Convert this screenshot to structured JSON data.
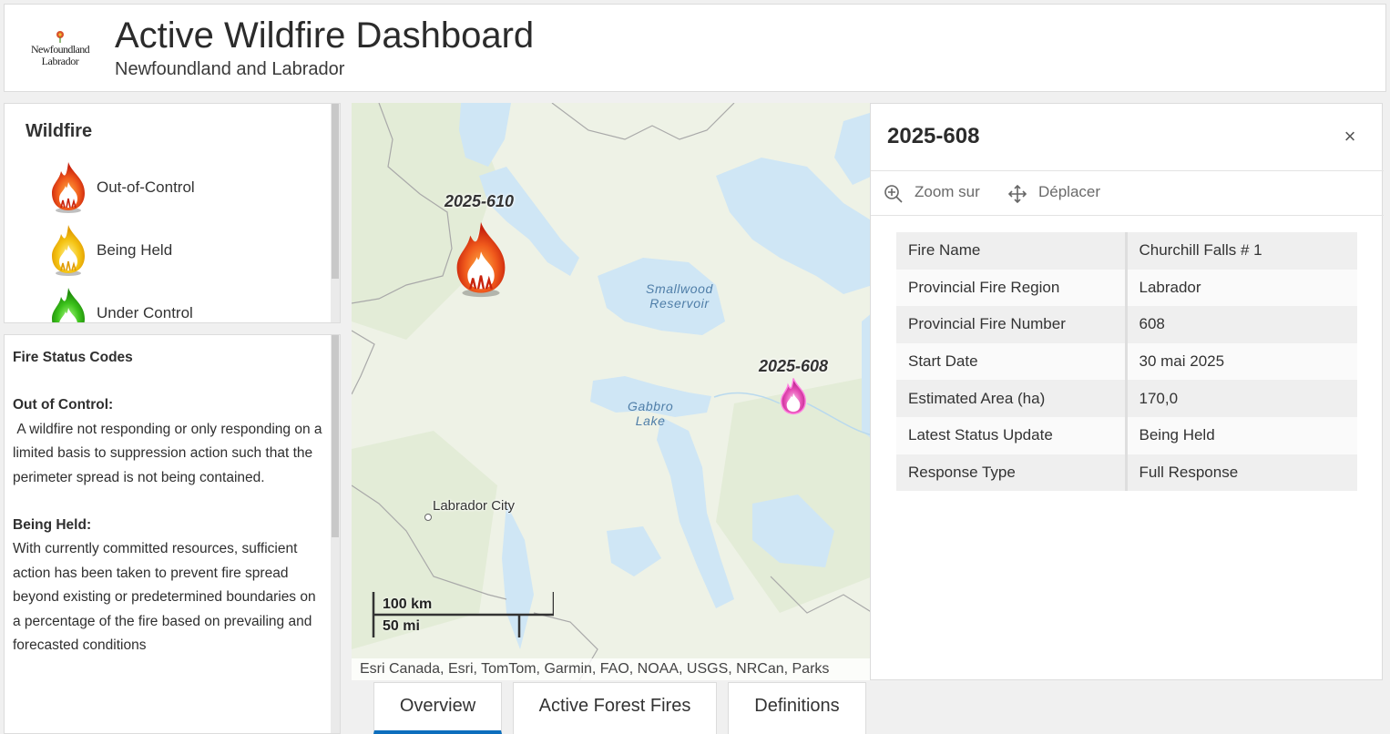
{
  "header": {
    "logo_line1": "Newfoundland",
    "logo_line2": "Labrador",
    "title": "Active Wildfire Dashboard",
    "subtitle": "Newfoundland and Labrador"
  },
  "legend": {
    "title": "Wildfire",
    "items": [
      {
        "label": "Out-of-Control",
        "color": "#e8441c"
      },
      {
        "label": "Being Held",
        "color": "#f5c515"
      },
      {
        "label": "Under Control",
        "color": "#3cc21b"
      }
    ]
  },
  "status_codes": {
    "title": "Fire Status Codes",
    "out_of_control_heading": "Out of Control:",
    "out_of_control_text": " A wildfire not responding or only responding on a limited basis to suppression action such that the perimeter spread is not being contained.",
    "being_held_heading": "Being Held:",
    "being_held_text": "With currently committed resources, sufficient action has been taken to prevent fire spread beyond existing or predetermined boundaries on a percentage of the fire based on prevailing and forecasted conditions"
  },
  "map": {
    "labels": {
      "smallwood": "Smallwood\nReservoir",
      "gabbro": "Gabbro\nLake",
      "labrador_city": "Labrador City"
    },
    "fires": [
      {
        "id": "2025-610",
        "status_color": "#e8441c"
      },
      {
        "id": "2025-608",
        "status_color": "#e64fb5"
      }
    ],
    "scale_km": "100 km",
    "scale_mi": "50 mi",
    "attribution": "Esri Canada, Esri, TomTom, Garmin, FAO, NOAA, USGS, NRCan, Parks"
  },
  "popup": {
    "title": "2025-608",
    "close_label": "×",
    "actions": {
      "zoom": "Zoom sur",
      "move": "Déplacer"
    },
    "rows": [
      {
        "key": "Fire Name",
        "value": "Churchill Falls # 1"
      },
      {
        "key": "Provincial Fire Region",
        "value": "Labrador"
      },
      {
        "key": "Provincial Fire Number",
        "value": "608"
      },
      {
        "key": "Start Date",
        "value": "30 mai 2025"
      },
      {
        "key": "Estimated Area (ha)",
        "value": "170,0"
      },
      {
        "key": "Latest Status Update",
        "value": "Being Held"
      },
      {
        "key": "Response Type",
        "value": "Full Response"
      }
    ]
  },
  "tabs": [
    {
      "label": "Overview",
      "active": true
    },
    {
      "label": "Active Forest Fires",
      "active": false
    },
    {
      "label": "Definitions",
      "active": false
    }
  ],
  "colors": {
    "accent": "#0d6ebd",
    "water": "#cfe6f5",
    "land": "#eef2e6"
  }
}
